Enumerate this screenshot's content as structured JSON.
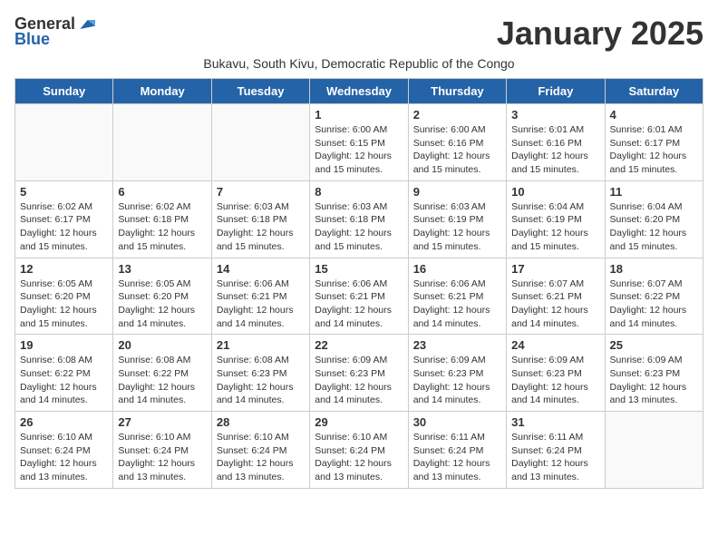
{
  "logo": {
    "general": "General",
    "blue": "Blue"
  },
  "header": {
    "month_title": "January 2025",
    "subtitle": "Bukavu, South Kivu, Democratic Republic of the Congo"
  },
  "weekdays": [
    "Sunday",
    "Monday",
    "Tuesday",
    "Wednesday",
    "Thursday",
    "Friday",
    "Saturday"
  ],
  "weeks": [
    [
      {
        "day": "",
        "info": ""
      },
      {
        "day": "",
        "info": ""
      },
      {
        "day": "",
        "info": ""
      },
      {
        "day": "1",
        "info": "Sunrise: 6:00 AM\nSunset: 6:15 PM\nDaylight: 12 hours\nand 15 minutes."
      },
      {
        "day": "2",
        "info": "Sunrise: 6:00 AM\nSunset: 6:16 PM\nDaylight: 12 hours\nand 15 minutes."
      },
      {
        "day": "3",
        "info": "Sunrise: 6:01 AM\nSunset: 6:16 PM\nDaylight: 12 hours\nand 15 minutes."
      },
      {
        "day": "4",
        "info": "Sunrise: 6:01 AM\nSunset: 6:17 PM\nDaylight: 12 hours\nand 15 minutes."
      }
    ],
    [
      {
        "day": "5",
        "info": "Sunrise: 6:02 AM\nSunset: 6:17 PM\nDaylight: 12 hours\nand 15 minutes."
      },
      {
        "day": "6",
        "info": "Sunrise: 6:02 AM\nSunset: 6:18 PM\nDaylight: 12 hours\nand 15 minutes."
      },
      {
        "day": "7",
        "info": "Sunrise: 6:03 AM\nSunset: 6:18 PM\nDaylight: 12 hours\nand 15 minutes."
      },
      {
        "day": "8",
        "info": "Sunrise: 6:03 AM\nSunset: 6:18 PM\nDaylight: 12 hours\nand 15 minutes."
      },
      {
        "day": "9",
        "info": "Sunrise: 6:03 AM\nSunset: 6:19 PM\nDaylight: 12 hours\nand 15 minutes."
      },
      {
        "day": "10",
        "info": "Sunrise: 6:04 AM\nSunset: 6:19 PM\nDaylight: 12 hours\nand 15 minutes."
      },
      {
        "day": "11",
        "info": "Sunrise: 6:04 AM\nSunset: 6:20 PM\nDaylight: 12 hours\nand 15 minutes."
      }
    ],
    [
      {
        "day": "12",
        "info": "Sunrise: 6:05 AM\nSunset: 6:20 PM\nDaylight: 12 hours\nand 15 minutes."
      },
      {
        "day": "13",
        "info": "Sunrise: 6:05 AM\nSunset: 6:20 PM\nDaylight: 12 hours\nand 14 minutes."
      },
      {
        "day": "14",
        "info": "Sunrise: 6:06 AM\nSunset: 6:21 PM\nDaylight: 12 hours\nand 14 minutes."
      },
      {
        "day": "15",
        "info": "Sunrise: 6:06 AM\nSunset: 6:21 PM\nDaylight: 12 hours\nand 14 minutes."
      },
      {
        "day": "16",
        "info": "Sunrise: 6:06 AM\nSunset: 6:21 PM\nDaylight: 12 hours\nand 14 minutes."
      },
      {
        "day": "17",
        "info": "Sunrise: 6:07 AM\nSunset: 6:21 PM\nDaylight: 12 hours\nand 14 minutes."
      },
      {
        "day": "18",
        "info": "Sunrise: 6:07 AM\nSunset: 6:22 PM\nDaylight: 12 hours\nand 14 minutes."
      }
    ],
    [
      {
        "day": "19",
        "info": "Sunrise: 6:08 AM\nSunset: 6:22 PM\nDaylight: 12 hours\nand 14 minutes."
      },
      {
        "day": "20",
        "info": "Sunrise: 6:08 AM\nSunset: 6:22 PM\nDaylight: 12 hours\nand 14 minutes."
      },
      {
        "day": "21",
        "info": "Sunrise: 6:08 AM\nSunset: 6:23 PM\nDaylight: 12 hours\nand 14 minutes."
      },
      {
        "day": "22",
        "info": "Sunrise: 6:09 AM\nSunset: 6:23 PM\nDaylight: 12 hours\nand 14 minutes."
      },
      {
        "day": "23",
        "info": "Sunrise: 6:09 AM\nSunset: 6:23 PM\nDaylight: 12 hours\nand 14 minutes."
      },
      {
        "day": "24",
        "info": "Sunrise: 6:09 AM\nSunset: 6:23 PM\nDaylight: 12 hours\nand 14 minutes."
      },
      {
        "day": "25",
        "info": "Sunrise: 6:09 AM\nSunset: 6:23 PM\nDaylight: 12 hours\nand 13 minutes."
      }
    ],
    [
      {
        "day": "26",
        "info": "Sunrise: 6:10 AM\nSunset: 6:24 PM\nDaylight: 12 hours\nand 13 minutes."
      },
      {
        "day": "27",
        "info": "Sunrise: 6:10 AM\nSunset: 6:24 PM\nDaylight: 12 hours\nand 13 minutes."
      },
      {
        "day": "28",
        "info": "Sunrise: 6:10 AM\nSunset: 6:24 PM\nDaylight: 12 hours\nand 13 minutes."
      },
      {
        "day": "29",
        "info": "Sunrise: 6:10 AM\nSunset: 6:24 PM\nDaylight: 12 hours\nand 13 minutes."
      },
      {
        "day": "30",
        "info": "Sunrise: 6:11 AM\nSunset: 6:24 PM\nDaylight: 12 hours\nand 13 minutes."
      },
      {
        "day": "31",
        "info": "Sunrise: 6:11 AM\nSunset: 6:24 PM\nDaylight: 12 hours\nand 13 minutes."
      },
      {
        "day": "",
        "info": ""
      }
    ]
  ]
}
